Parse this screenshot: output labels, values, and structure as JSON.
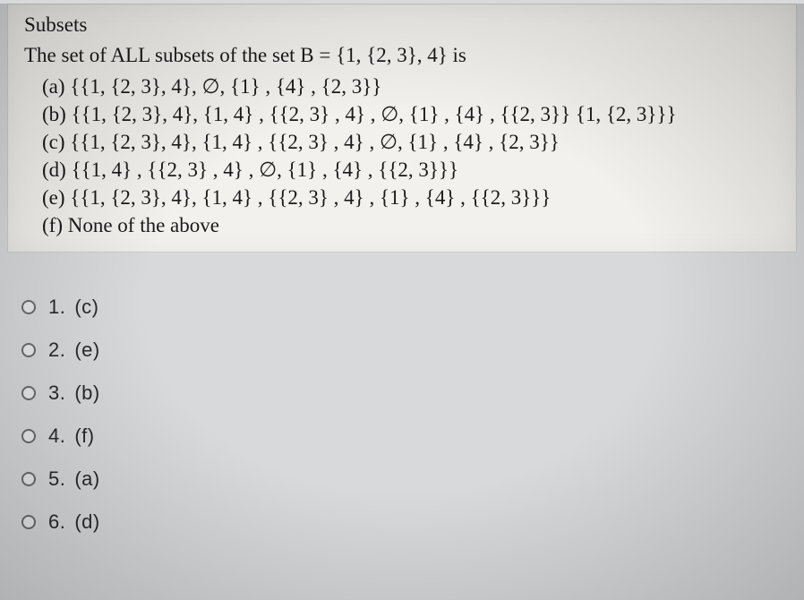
{
  "heading": "Subsets",
  "prompt": "The set of ALL subsets of the set B = {1, {2, 3}, 4} is",
  "options": {
    "a": "(a) {{1, {2, 3}, 4}, ∅, {1} , {4} , {2, 3}}",
    "b": "(b) {{1, {2, 3}, 4}, {1, 4} , {{2, 3} , 4} , ∅, {1} , {4} , {{2, 3}} {1, {2, 3}}}",
    "c": "(c) {{1, {2, 3}, 4}, {1, 4} , {{2, 3} , 4} , ∅, {1} , {4} , {2, 3}}",
    "d": "(d) {{1, 4} , {{2, 3} , 4} , ∅, {1} , {4} , {{2, 3}}}",
    "e": "(e) {{1, {2, 3}, 4}, {1, 4} , {{2, 3} , 4} , {1} , {4} , {{2, 3}}}",
    "f": "(f) None of the above"
  },
  "answers": [
    {
      "num": "1.",
      "text": "(c)"
    },
    {
      "num": "2.",
      "text": "(e)"
    },
    {
      "num": "3.",
      "text": "(b)"
    },
    {
      "num": "4.",
      "text": "(f)"
    },
    {
      "num": "5.",
      "text": "(a)"
    },
    {
      "num": "6.",
      "text": "(d)"
    }
  ]
}
